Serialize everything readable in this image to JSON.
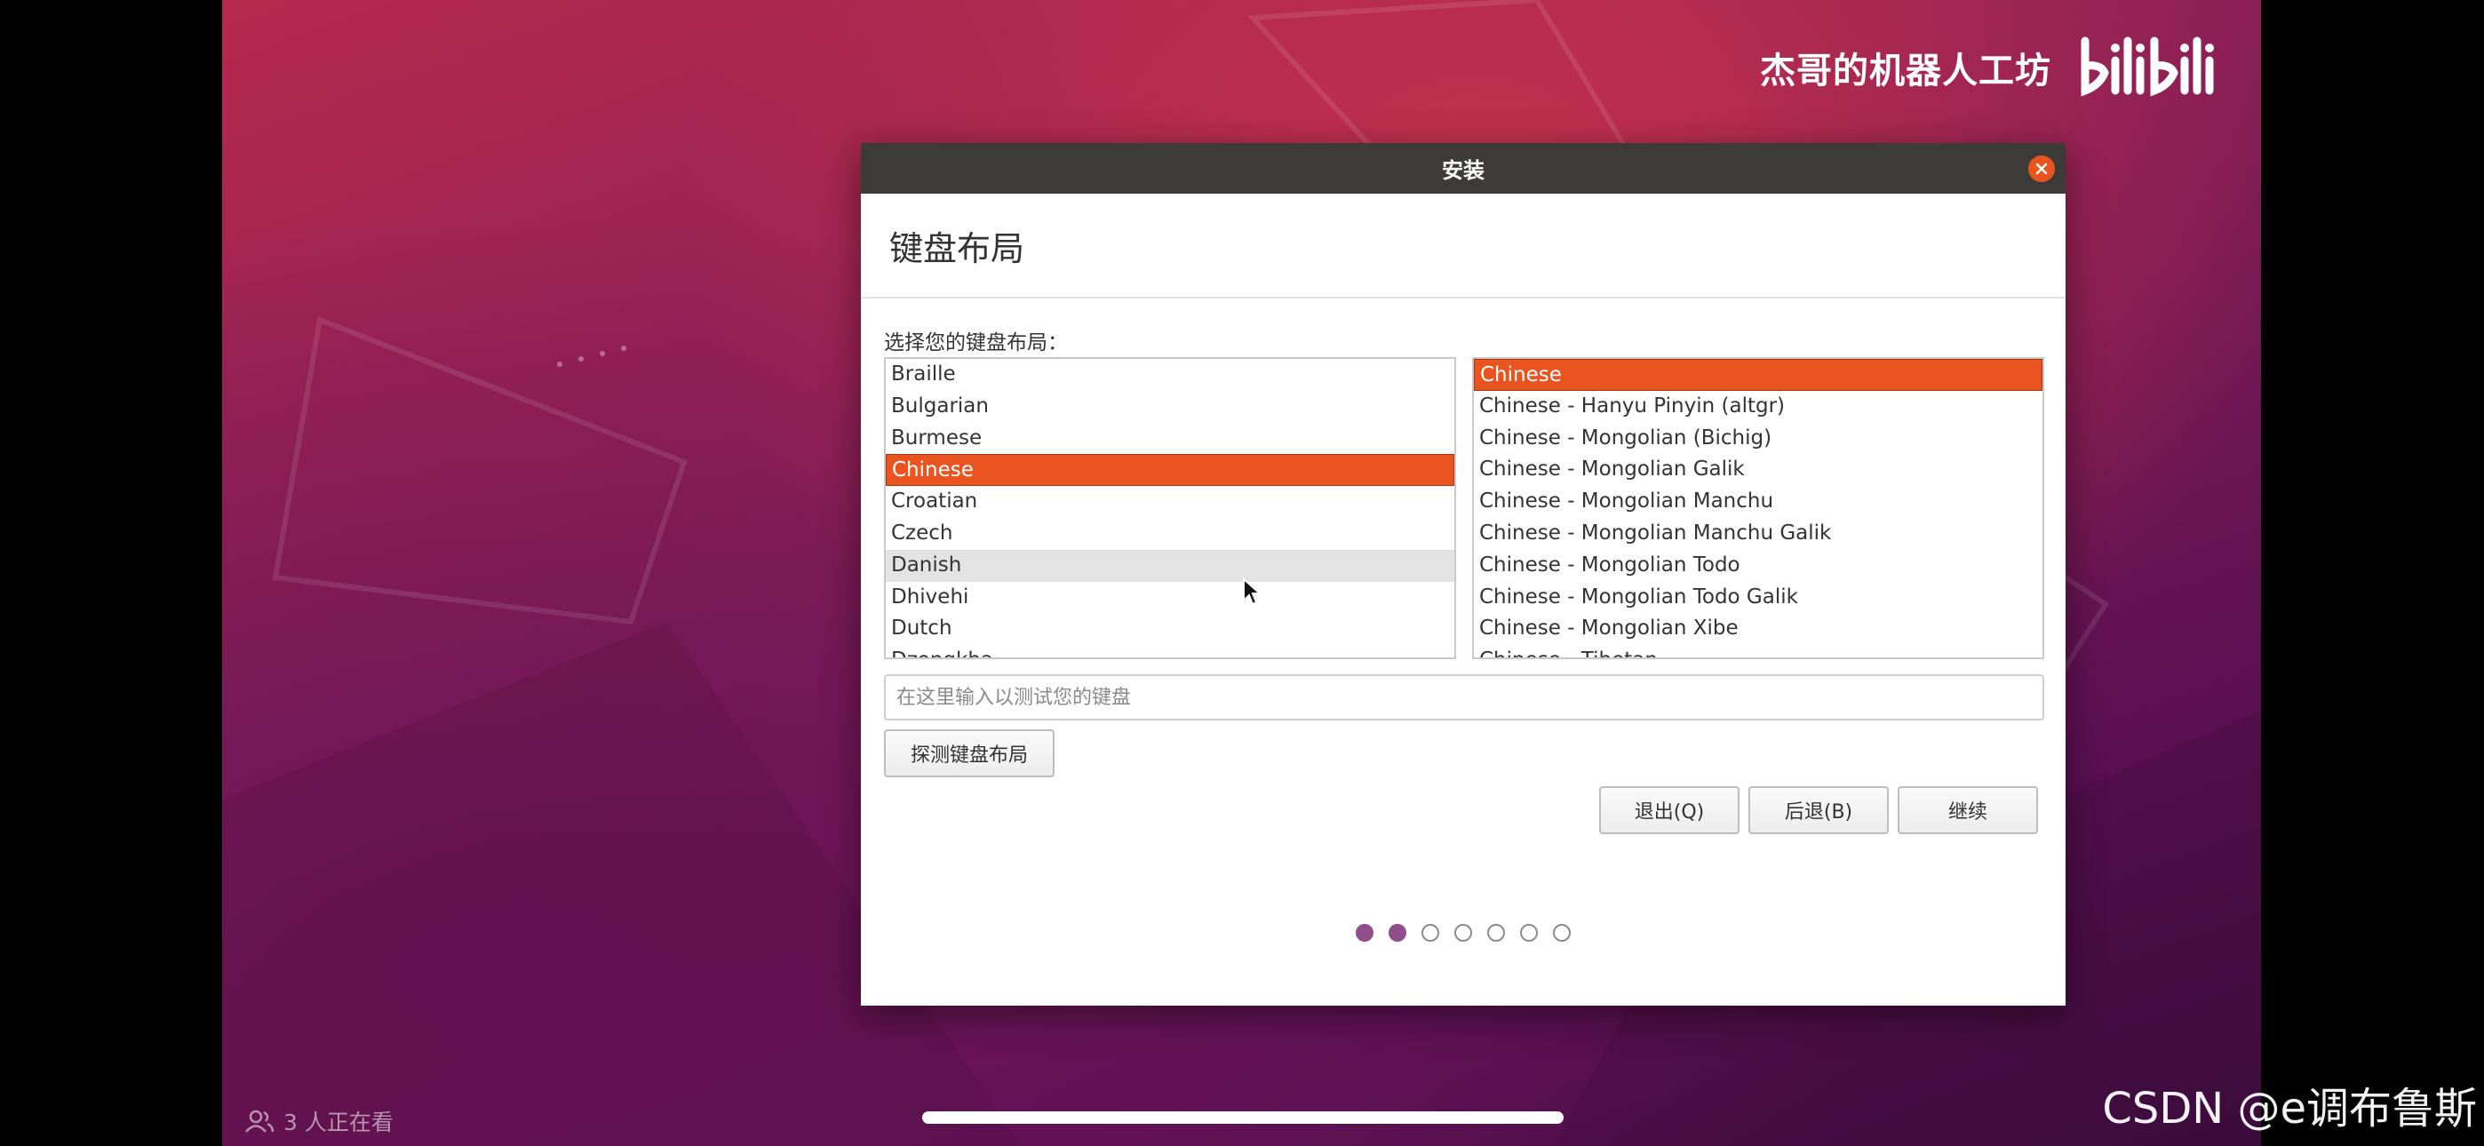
{
  "watermark": {
    "text": "杰哥的机器人工坊",
    "logo": "bilibili"
  },
  "viewers": {
    "icon": "people-icon",
    "text": "3 人正在看"
  },
  "csdn": {
    "text": "CSDN @e调布鲁斯"
  },
  "window": {
    "title": "安装",
    "heading": "键盘布局",
    "prompt": "选择您的键盘布局：",
    "layouts": [
      "Braille",
      "Bulgarian",
      "Burmese",
      "Chinese",
      "Croatian",
      "Czech",
      "Danish",
      "Dhivehi",
      "Dutch",
      "Dzongkha"
    ],
    "selected_layout": "Chinese",
    "hovered_layout": "Danish",
    "variants": [
      "Chinese",
      "Chinese - Hanyu Pinyin (altgr)",
      "Chinese - Mongolian (Bichig)",
      "Chinese - Mongolian Galik",
      "Chinese - Mongolian Manchu",
      "Chinese - Mongolian Manchu Galik",
      "Chinese - Mongolian Todo",
      "Chinese - Mongolian Todo Galik",
      "Chinese - Mongolian Xibe",
      "Chinese - Tibetan"
    ],
    "selected_variant": "Chinese",
    "test_placeholder": "在这里输入以测试您的键盘",
    "detect_button": "探测键盘布局",
    "quit_button": "退出(Q)",
    "back_button": "后退(B)",
    "continue_button": "继续",
    "progress": {
      "total_steps": 7,
      "completed_steps": 2
    }
  },
  "colors": {
    "accent": "#e95420",
    "progress_done": "#924d8b",
    "titlebar": "#3c3b37"
  }
}
